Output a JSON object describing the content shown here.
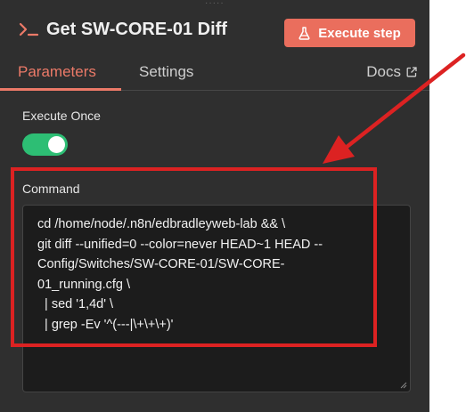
{
  "node": {
    "title": "Get SW-CORE-01 Diff",
    "icon": "terminal-icon"
  },
  "header": {
    "execute_label": "Execute step",
    "execute_icon": "flask-icon",
    "drag_handle": "·····"
  },
  "tabs": [
    {
      "label": "Parameters",
      "active": true
    },
    {
      "label": "Settings",
      "active": false
    }
  ],
  "docs": {
    "label": "Docs",
    "icon": "external-link-icon"
  },
  "execute_once": {
    "label": "Execute Once",
    "enabled": true
  },
  "command": {
    "label": "Command",
    "lines": [
      "cd /home/node/.n8n/edbradleyweb-lab && \\",
      "git diff --unified=0 --color=never HEAD~1 HEAD --",
      "Config/Switches/SW-CORE-01/SW-CORE-",
      "01_running.cfg \\",
      "  | sed '1,4d' \\",
      "  | grep -Ev '^(---|\\+\\+\\+)'"
    ]
  },
  "colors": {
    "accent": "#ea6e5d",
    "toggle_on": "#2dbe74",
    "annotation": "#dc2222",
    "panel_bg": "#2f2f2f"
  }
}
